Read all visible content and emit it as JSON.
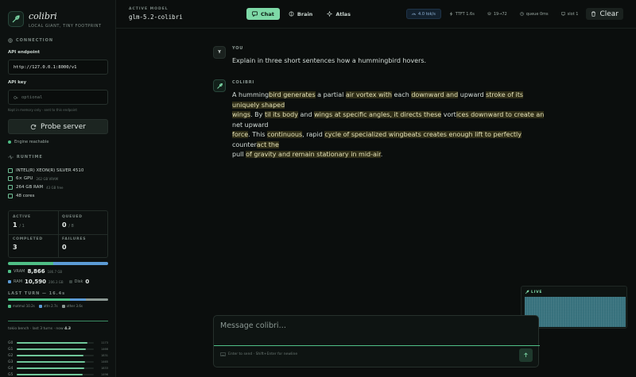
{
  "sidebar": {
    "brand_name": "colibri",
    "brand_tagline": "LOCAL GIANT, TINY FOOTPRINT",
    "connection_label": "CONNECTION",
    "api_endpoint_label": "API endpoint",
    "api_endpoint_value": "http://127.0.0.1:8000/v1",
    "api_key_label": "API key",
    "api_key_placeholder": "optional",
    "api_key_hint": "Kept in memory only · sent to this endpoint",
    "probe_button": "Probe server",
    "engine_status": "Engine reachable",
    "runtime_label": "RUNTIME",
    "runtime": {
      "cpu": "INTEL(R) XEON(R) SILVER 4510",
      "gpu": "6× GPU",
      "gpu_sub": "262 GB VRAM",
      "ram": "264 GB RAM",
      "ram_sub": "43 GB free",
      "cores": "48 cores"
    },
    "stats": {
      "active_label": "ACTIVE",
      "active_value": "1",
      "active_of": "/ 1",
      "queued_label": "QUEUED",
      "queued_value": "0",
      "queued_of": "/ 8",
      "completed_label": "COMPLETED",
      "completed_value": "3",
      "failures_label": "FAILURES",
      "failures_value": "0"
    },
    "memory": {
      "vram_fraction": 0.45,
      "vram_label": "VRAM",
      "vram_value": "8,866",
      "vram_sub": "186.7 GB",
      "ram_label": "RAM",
      "ram_value": "10,590",
      "ram_sub": "206.3 GB",
      "disk_label": "Disk",
      "disk_value": "0"
    },
    "last_turn": {
      "label": "LAST TURN — 16.4s",
      "legend": [
        "matmul 10.2s",
        "attn 2.7s",
        "other 3.6s"
      ],
      "parts": [
        0.62,
        0.16,
        0.22
      ]
    },
    "gpu_caption": "tokio bench · last 3 turns · now",
    "gpu_caption_value": "4.3",
    "gpus": [
      {
        "label": "G0",
        "value": "1173",
        "fraction": 0.92
      },
      {
        "label": "G1",
        "value": "1466",
        "fraction": 0.9
      },
      {
        "label": "G2",
        "value": "1831",
        "fraction": 0.87
      },
      {
        "label": "G3",
        "value": "1465",
        "fraction": 0.89
      },
      {
        "label": "G4",
        "value": "1833",
        "fraction": 0.88
      },
      {
        "label": "G5",
        "value": "1496",
        "fraction": 0.86
      }
    ]
  },
  "topbar": {
    "active_model_label": "ACTIVE MODEL",
    "active_model_value": "glm-5.2-colibri",
    "tabs": [
      "Chat",
      "Brain",
      "Atlas"
    ],
    "speed": "4.0 tok/s",
    "ttft": "TTFT 1.6s",
    "tokens": "19→72",
    "queue": "queue 0ms",
    "slot": "slot 1",
    "clear": "Clear"
  },
  "chat": {
    "user_avatar": "Y",
    "user_label": "YOU",
    "user_message": "Explain in three short sentences how a hummingbird hovers.",
    "bot_label": "COLIBRI",
    "bot_line_1": [
      {
        "t": "A humming",
        "h": false
      },
      {
        "t": "bird generates",
        "h": true
      },
      {
        "t": " a partial ",
        "h": false
      },
      {
        "t": "air vortex with",
        "h": true
      },
      {
        "t": " each ",
        "h": false
      },
      {
        "t": "downward and",
        "h": true
      },
      {
        "t": " upward ",
        "h": false
      },
      {
        "t": "stroke of its uniquely shaped",
        "h": true
      }
    ],
    "bot_line_2": [
      {
        "t": "wings",
        "h": true
      },
      {
        "t": ". By ",
        "h": false
      },
      {
        "t": "til its body",
        "h": true
      },
      {
        "t": " and ",
        "h": false
      },
      {
        "t": "wings at specific angles, it directs these",
        "h": true
      },
      {
        "t": " vort",
        "h": false
      },
      {
        "t": "ices downward to create an",
        "h": true
      },
      {
        "t": " net upward",
        "h": false
      }
    ],
    "bot_line_3": [
      {
        "t": "force",
        "h": true
      },
      {
        "t": ". This ",
        "h": false
      },
      {
        "t": "continuous",
        "h": true
      },
      {
        "t": ", rapid ",
        "h": false
      },
      {
        "t": "cycle of specialized wingbeats creates enough lift to perfectly",
        "h": true
      },
      {
        "t": " counter",
        "h": false
      },
      {
        "t": "act the",
        "h": true
      }
    ],
    "bot_line_4": [
      {
        "t": "pull ",
        "h": false
      },
      {
        "t": "of gravity and remain stationary in mid-air",
        "h": true
      },
      {
        "t": ".",
        "h": false
      }
    ]
  },
  "live": {
    "label": "LIVE"
  },
  "composer": {
    "placeholder": "Message colibri…",
    "hint": "Enter to send · Shift+Enter for newline"
  },
  "colors": {
    "accent": "#7ed9a7",
    "vram": "#4fbf86",
    "ram": "#5b9bd5",
    "highlight": "#b0a03c"
  }
}
